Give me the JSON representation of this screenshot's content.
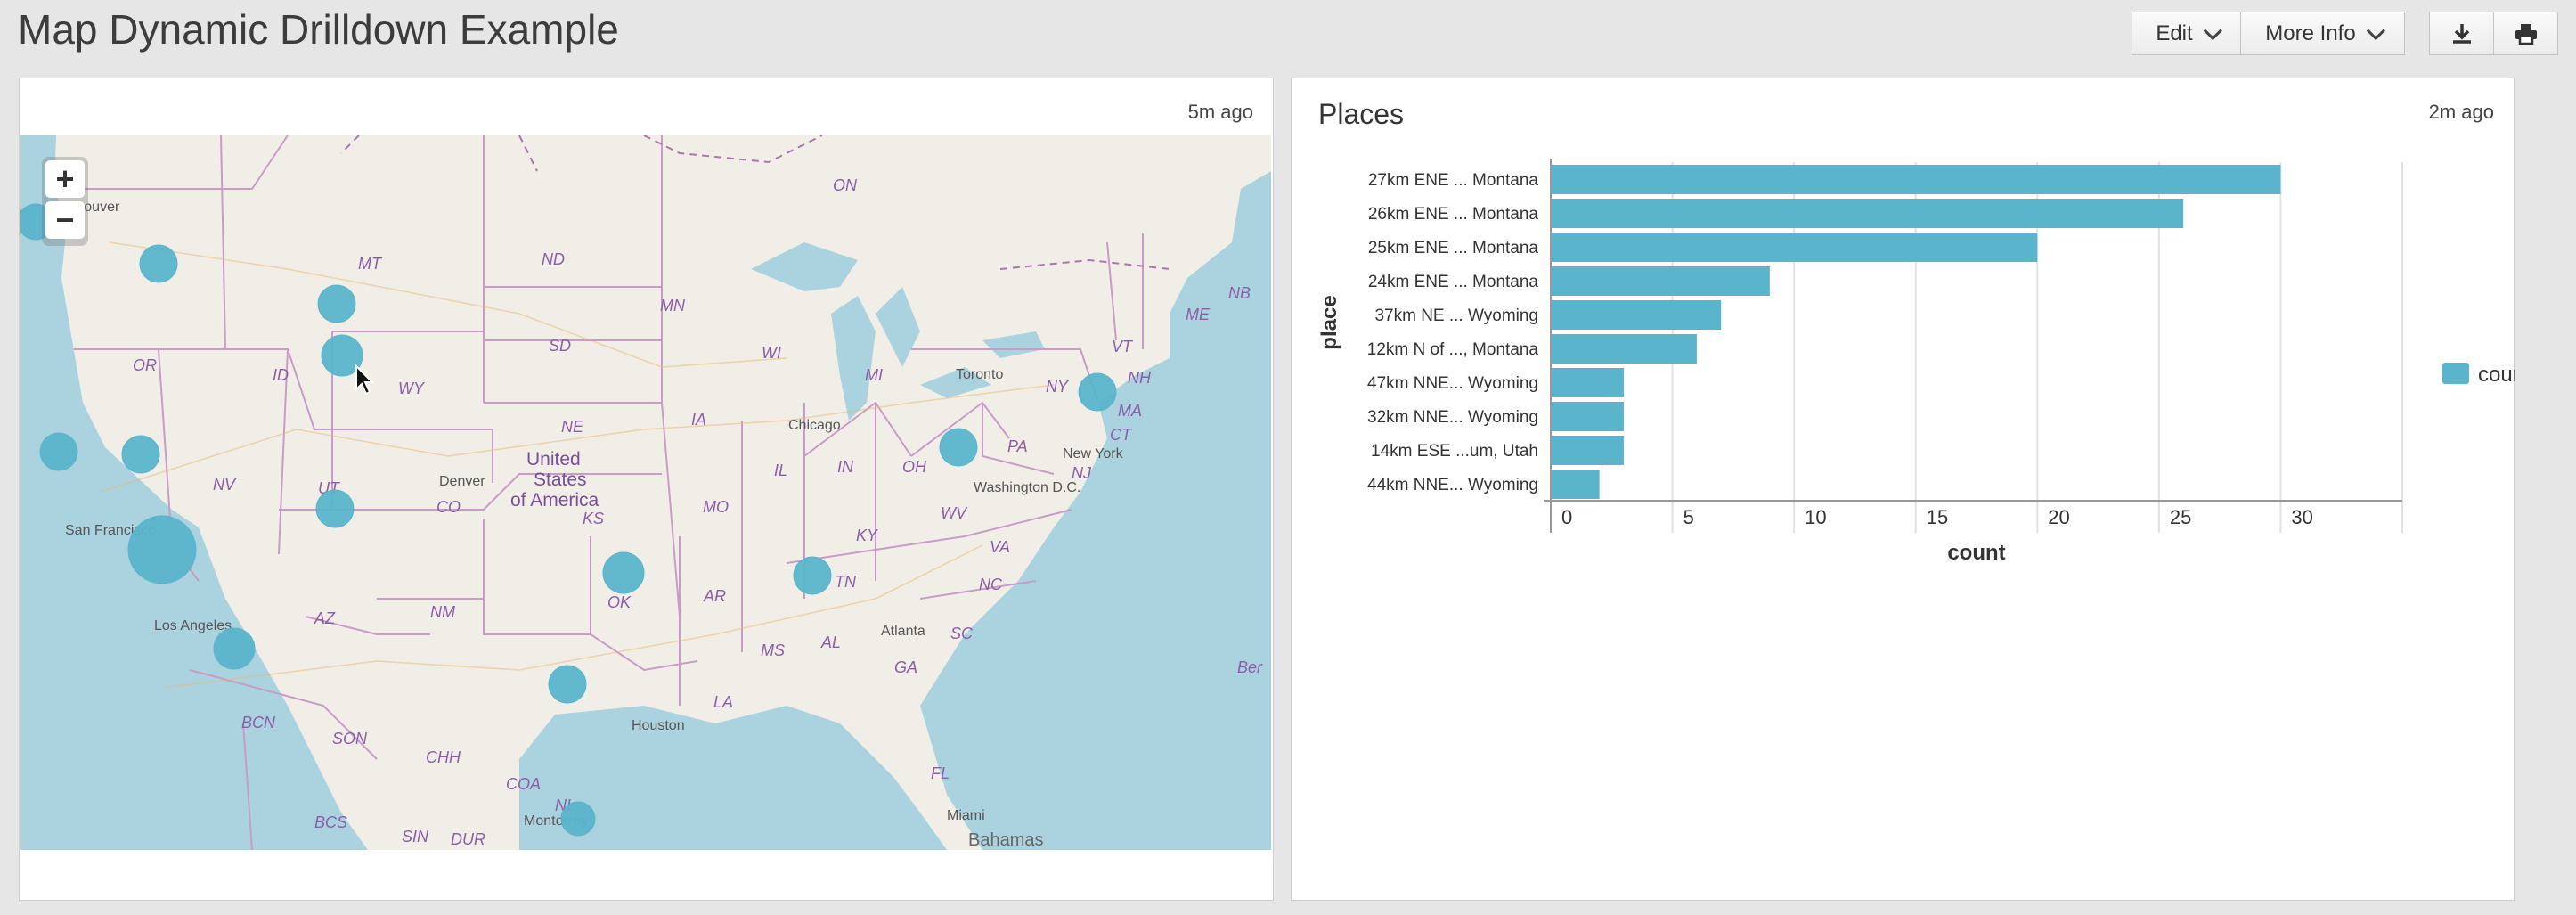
{
  "page": {
    "title": "Map Dynamic Drilldown Example"
  },
  "toolbar": {
    "edit_label": "Edit",
    "more_info_label": "More Info",
    "export_icon": "download-icon",
    "print_icon": "print-icon"
  },
  "map_panel": {
    "time": "5m ago",
    "zoom_in": "+",
    "zoom_out": "−",
    "labels": [
      {
        "text": "ON",
        "cls": "state"
      },
      {
        "text": "MT",
        "cls": "state"
      },
      {
        "text": "ND",
        "cls": "state"
      },
      {
        "text": "MN",
        "cls": "state"
      },
      {
        "text": "WI",
        "cls": "state"
      },
      {
        "text": "MI",
        "cls": "state"
      },
      {
        "text": "SD",
        "cls": "state"
      },
      {
        "text": "WY",
        "cls": "state"
      },
      {
        "text": "ID",
        "cls": "state"
      },
      {
        "text": "OR",
        "cls": "state"
      },
      {
        "text": "NE",
        "cls": "state"
      },
      {
        "text": "IA",
        "cls": "state"
      },
      {
        "text": "NV",
        "cls": "state"
      },
      {
        "text": "UT",
        "cls": "state"
      },
      {
        "text": "CO",
        "cls": "state"
      },
      {
        "text": "KS",
        "cls": "state"
      },
      {
        "text": "MO",
        "cls": "state"
      },
      {
        "text": "IL",
        "cls": "state"
      },
      {
        "text": "IN",
        "cls": "state"
      },
      {
        "text": "OH",
        "cls": "state"
      },
      {
        "text": "PA",
        "cls": "state"
      },
      {
        "text": "NY",
        "cls": "state"
      },
      {
        "text": "VT",
        "cls": "state"
      },
      {
        "text": "NH",
        "cls": "state"
      },
      {
        "text": "ME",
        "cls": "state"
      },
      {
        "text": "NB",
        "cls": "state"
      },
      {
        "text": "MA",
        "cls": "state"
      },
      {
        "text": "CT",
        "cls": "state"
      },
      {
        "text": "NJ",
        "cls": "state"
      },
      {
        "text": "KY",
        "cls": "state"
      },
      {
        "text": "WV",
        "cls": "state"
      },
      {
        "text": "VA",
        "cls": "state"
      },
      {
        "text": "NC",
        "cls": "state"
      },
      {
        "text": "TN",
        "cls": "state"
      },
      {
        "text": "SC",
        "cls": "state"
      },
      {
        "text": "OK",
        "cls": "state"
      },
      {
        "text": "AR",
        "cls": "state"
      },
      {
        "text": "AL",
        "cls": "state"
      },
      {
        "text": "GA",
        "cls": "state"
      },
      {
        "text": "MS",
        "cls": "state"
      },
      {
        "text": "LA",
        "cls": "state"
      },
      {
        "text": "FL",
        "cls": "state"
      },
      {
        "text": "AZ",
        "cls": "state"
      },
      {
        "text": "NM",
        "cls": "state"
      },
      {
        "text": "BCN",
        "cls": "state"
      },
      {
        "text": "SON",
        "cls": "state"
      },
      {
        "text": "CHH",
        "cls": "state"
      },
      {
        "text": "COA",
        "cls": "state"
      },
      {
        "text": "BCS",
        "cls": "state"
      },
      {
        "text": "SIN",
        "cls": "state"
      },
      {
        "text": "DUR",
        "cls": "state"
      },
      {
        "text": "NL",
        "cls": "state"
      },
      {
        "text": "Ber",
        "cls": "water"
      },
      {
        "text": "Chicago",
        "cls": "city"
      },
      {
        "text": "Toronto",
        "cls": "city"
      },
      {
        "text": "Denver",
        "cls": "city"
      },
      {
        "text": "New York",
        "cls": "city"
      },
      {
        "text": "Washington D.C.",
        "cls": "city"
      },
      {
        "text": "Atlanta",
        "cls": "city"
      },
      {
        "text": "Houston",
        "cls": "city"
      },
      {
        "text": "Los Angeles",
        "cls": "city"
      },
      {
        "text": "San Francisco",
        "cls": "city"
      },
      {
        "text": "Miami",
        "cls": "city"
      },
      {
        "text": "Monterrey",
        "cls": "city"
      },
      {
        "text": "Vancouver",
        "cls": "city"
      },
      {
        "text": "Bahamas",
        "cls": "region"
      },
      {
        "text": "United",
        "cls": "country"
      },
      {
        "text": "States",
        "cls": "country"
      },
      {
        "text": "of America",
        "cls": "country"
      }
    ],
    "marker_color": "#5ab4cb"
  },
  "chart_panel": {
    "title": "Places",
    "time": "2m ago"
  },
  "chart_data": {
    "type": "bar",
    "orientation": "horizontal",
    "categories": [
      "27km ENE ... Montana",
      "26km ENE ... Montana",
      "25km ENE ... Montana",
      "24km ENE ... Montana",
      "37km NE ... Wyoming",
      "12km N of ..., Montana",
      "47km NNE... Wyoming",
      "32km NNE... Wyoming",
      "14km ESE ...um, Utah",
      "44km NNE... Wyoming"
    ],
    "series": [
      {
        "name": "count",
        "values": [
          30,
          26,
          20,
          9,
          7,
          6,
          3,
          3,
          3,
          2
        ]
      }
    ],
    "xlabel": "count",
    "ylabel": "place",
    "xlim": [
      0,
      35
    ],
    "xticks": [
      "0",
      "5",
      "10",
      "15",
      "20",
      "25",
      "30"
    ],
    "grid": true,
    "legend": "right",
    "color": "#5ab4cb"
  }
}
